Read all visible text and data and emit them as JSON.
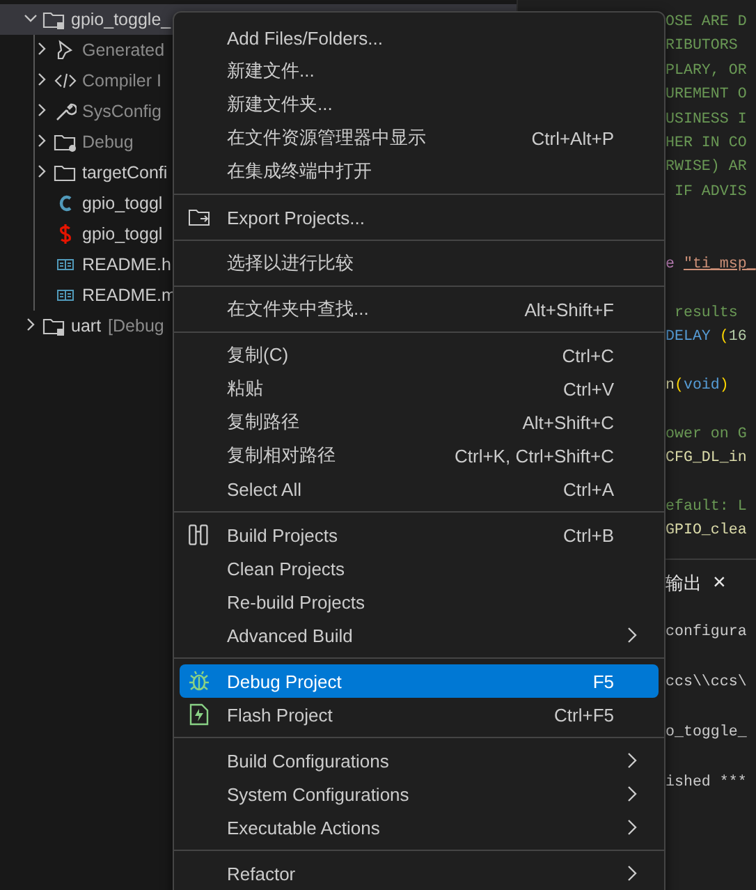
{
  "explorer": {
    "tree": [
      {
        "label": "gpio_toggle_",
        "kind": "project",
        "expanded": true,
        "selected": true,
        "dimmed": false,
        "children": [
          {
            "label": "Generated",
            "kind": "generated",
            "expanded": false,
            "selected": false,
            "dimmed": true
          },
          {
            "label": "Compiler I",
            "kind": "compiler",
            "expanded": false,
            "selected": false,
            "dimmed": true
          },
          {
            "label": "SysConfig",
            "kind": "sysconfig",
            "expanded": false,
            "selected": false,
            "dimmed": true
          },
          {
            "label": "Debug",
            "kind": "build-folder",
            "expanded": false,
            "selected": false,
            "dimmed": true
          },
          {
            "label": "targetConfi",
            "kind": "folder",
            "expanded": false,
            "selected": false,
            "dimmed": false
          },
          {
            "label": "gpio_toggl",
            "kind": "c-file",
            "selected": false,
            "dimmed": false
          },
          {
            "label": "gpio_toggl",
            "kind": "syscfg-file",
            "selected": false,
            "dimmed": false
          },
          {
            "label": "README.h",
            "kind": "readme-file",
            "selected": false,
            "dimmed": false
          },
          {
            "label": "README.m",
            "kind": "readme-file",
            "selected": false,
            "dimmed": false
          }
        ]
      },
      {
        "label": "uart",
        "suffix": "[Debug",
        "kind": "project",
        "expanded": false,
        "selected": false,
        "dimmed": false
      }
    ]
  },
  "editor": {
    "lines": [
      {
        "segments": [
          {
            "text": "OSE ARE D",
            "kind": "comment"
          }
        ]
      },
      {
        "segments": [
          {
            "text": "RIBUTORS",
            "kind": "comment"
          }
        ]
      },
      {
        "segments": [
          {
            "text": "PLARY, OR",
            "kind": "comment"
          }
        ]
      },
      {
        "segments": [
          {
            "text": "UREMENT O",
            "kind": "comment"
          }
        ]
      },
      {
        "segments": [
          {
            "text": "USINESS I",
            "kind": "comment"
          }
        ]
      },
      {
        "segments": [
          {
            "text": "HER IN CO",
            "kind": "comment"
          }
        ]
      },
      {
        "segments": [
          {
            "text": "RWISE) AR",
            "kind": "comment"
          }
        ]
      },
      {
        "segments": [
          {
            "text": " IF ADVIS",
            "kind": "comment"
          }
        ]
      },
      {
        "blank": true
      },
      {
        "blank": true
      },
      {
        "segments": [
          {
            "text": "e ",
            "kind": "keyword"
          },
          {
            "text": "\"ti_msp_",
            "kind": "string"
          }
        ]
      },
      {
        "blank": true
      },
      {
        "segments": [
          {
            "text": " results",
            "kind": "comment"
          }
        ]
      },
      {
        "segments": [
          {
            "text": "DELAY ",
            "kind": "macro"
          },
          {
            "text": "(",
            "kind": "bracket"
          },
          {
            "text": "16",
            "kind": "number"
          }
        ]
      },
      {
        "blank": true
      },
      {
        "segments": [
          {
            "text": "n",
            "kind": "function"
          },
          {
            "text": "(",
            "kind": "bracket"
          },
          {
            "text": "void",
            "kind": "macro"
          },
          {
            "text": ")",
            "kind": "bracket"
          }
        ]
      },
      {
        "blank": true
      },
      {
        "segments": [
          {
            "text": "ower on G",
            "kind": "comment"
          }
        ]
      },
      {
        "segments": [
          {
            "text": "CFG_DL_in",
            "kind": "function"
          }
        ]
      },
      {
        "blank": true
      },
      {
        "segments": [
          {
            "text": "efault: L",
            "kind": "comment"
          }
        ]
      },
      {
        "segments": [
          {
            "text": "GPIO_clea",
            "kind": "function"
          }
        ]
      }
    ]
  },
  "panel": {
    "tab": {
      "label": "输出",
      "close": "×"
    },
    "lines": [
      "configura",
      "ccs\\\\ccs\\",
      "o_toggle_",
      "ished ***"
    ]
  },
  "context_menu": {
    "groups": [
      [
        {
          "label": "Add Files/Folders...",
          "kind": "plain",
          "selected": false
        },
        {
          "label": "新建文件...",
          "kind": "plain",
          "selected": false
        },
        {
          "label": "新建文件夹...",
          "kind": "plain",
          "selected": false
        },
        {
          "label": "在文件资源管理器中显示",
          "shortcut": "Ctrl+Alt+P",
          "kind": "plain",
          "selected": false
        },
        {
          "label": "在集成终端中打开",
          "kind": "plain",
          "selected": false
        }
      ],
      [
        {
          "label": "Export Projects...",
          "kind": "export",
          "selected": false
        }
      ],
      [
        {
          "label": "选择以进行比较",
          "kind": "plain",
          "selected": false
        }
      ],
      [
        {
          "label": "在文件夹中查找...",
          "shortcut": "Alt+Shift+F",
          "kind": "plain",
          "selected": false
        }
      ],
      [
        {
          "label": "复制(C)",
          "shortcut": "Ctrl+C",
          "kind": "plain",
          "selected": false
        },
        {
          "label": "粘贴",
          "shortcut": "Ctrl+V",
          "kind": "plain",
          "selected": false
        },
        {
          "label": "复制路径",
          "shortcut": "Alt+Shift+C",
          "kind": "plain",
          "selected": false
        },
        {
          "label": "复制相对路径",
          "shortcut": "Ctrl+K, Ctrl+Shift+C",
          "kind": "plain",
          "selected": false
        },
        {
          "label": "Select All",
          "shortcut": "Ctrl+A",
          "kind": "plain",
          "selected": false
        }
      ],
      [
        {
          "label": "Build Projects",
          "shortcut": "Ctrl+B",
          "kind": "build",
          "selected": false
        },
        {
          "label": "Clean Projects",
          "kind": "plain",
          "selected": false
        },
        {
          "label": "Re-build Projects",
          "kind": "plain",
          "selected": false
        },
        {
          "label": "Advanced Build",
          "kind": "plain",
          "submenu": true,
          "selected": false
        }
      ],
      [
        {
          "label": "Debug Project",
          "shortcut": "F5",
          "kind": "debug",
          "selected": true
        },
        {
          "label": "Flash Project",
          "shortcut": "Ctrl+F5",
          "kind": "flash",
          "selected": false
        }
      ],
      [
        {
          "label": "Build Configurations",
          "kind": "plain",
          "submenu": true,
          "selected": false
        },
        {
          "label": "System Configurations",
          "kind": "plain",
          "submenu": true,
          "selected": false
        },
        {
          "label": "Executable Actions",
          "kind": "plain",
          "submenu": true,
          "selected": false
        }
      ],
      [
        {
          "label": "Refactor",
          "kind": "plain",
          "submenu": true,
          "selected": false
        }
      ]
    ]
  }
}
